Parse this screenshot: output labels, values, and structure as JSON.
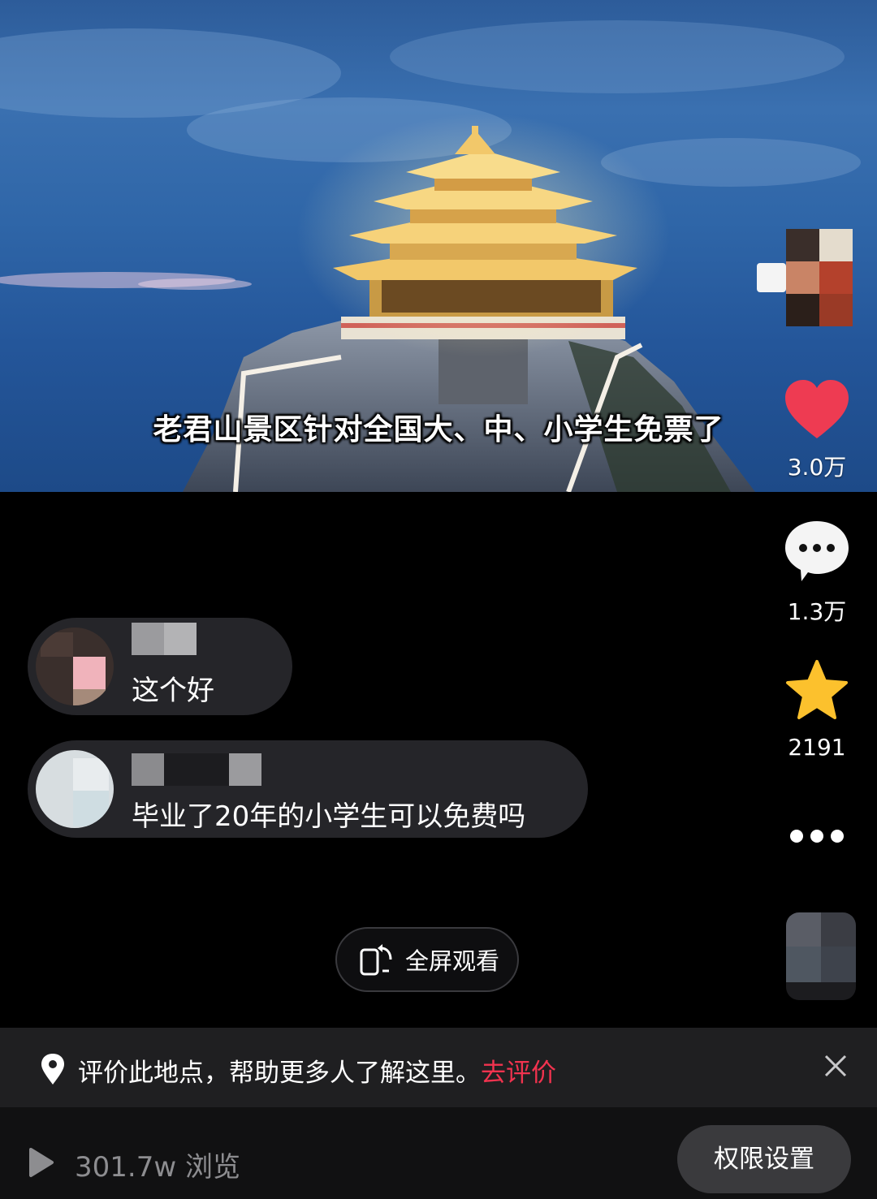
{
  "video": {
    "subtitle": "老君山景区针对全国大、中、小学生免票了"
  },
  "actions": {
    "like_count": "3.0万",
    "comment_count": "1.3万",
    "favorite_count": "2191",
    "like_color": "#ee3b52",
    "favorite_color": "#fcc12d"
  },
  "comments": [
    {
      "text": "这个好"
    },
    {
      "text": "毕业了20年的小学生可以免费吗"
    }
  ],
  "fullscreen": {
    "label": "全屏观看"
  },
  "location_prompt": {
    "text": "评价此地点，帮助更多人了解这里。",
    "cta": "去评价",
    "cta_color": "#f2334f"
  },
  "stats": {
    "views": "301.7w 浏览",
    "permission_button": "权限设置"
  }
}
